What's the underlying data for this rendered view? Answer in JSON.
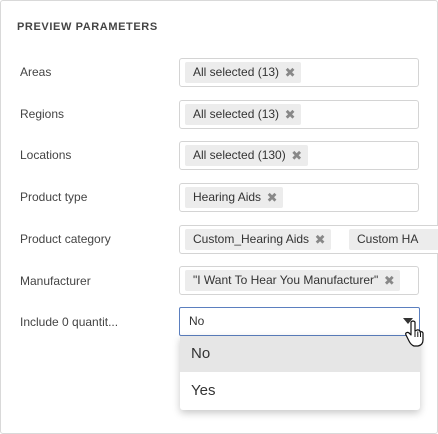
{
  "panel": {
    "title": "PREVIEW PARAMETERS"
  },
  "areas": {
    "label": "Areas",
    "chips": [
      "All selected (13)"
    ]
  },
  "regions": {
    "label": "Regions",
    "chips": [
      "All selected (13)"
    ]
  },
  "locations": {
    "label": "Locations",
    "chips": [
      "All selected (130)"
    ]
  },
  "product_type": {
    "label": "Product type",
    "chips": [
      "Hearing Aids"
    ]
  },
  "product_category": {
    "label": "Product category",
    "chips": [
      "Custom_Hearing Aids",
      "Custom HA"
    ]
  },
  "manufacturer": {
    "label": "Manufacturer",
    "chips": [
      "\"I Want To Hear You Manufacturer\""
    ]
  },
  "include_zero": {
    "label": "Include 0 quantit...",
    "value": "No",
    "options": [
      "No",
      "Yes"
    ],
    "hovered_option": "No"
  },
  "icons": {
    "chip_remove": "close-icon",
    "dropdown": "chevron-down-icon",
    "cursor": "hand-pointer-icon"
  },
  "colors": {
    "select_border": "#5b7fbf",
    "chip_bg": "#ececec",
    "option_hover": "#e6e6e6"
  }
}
